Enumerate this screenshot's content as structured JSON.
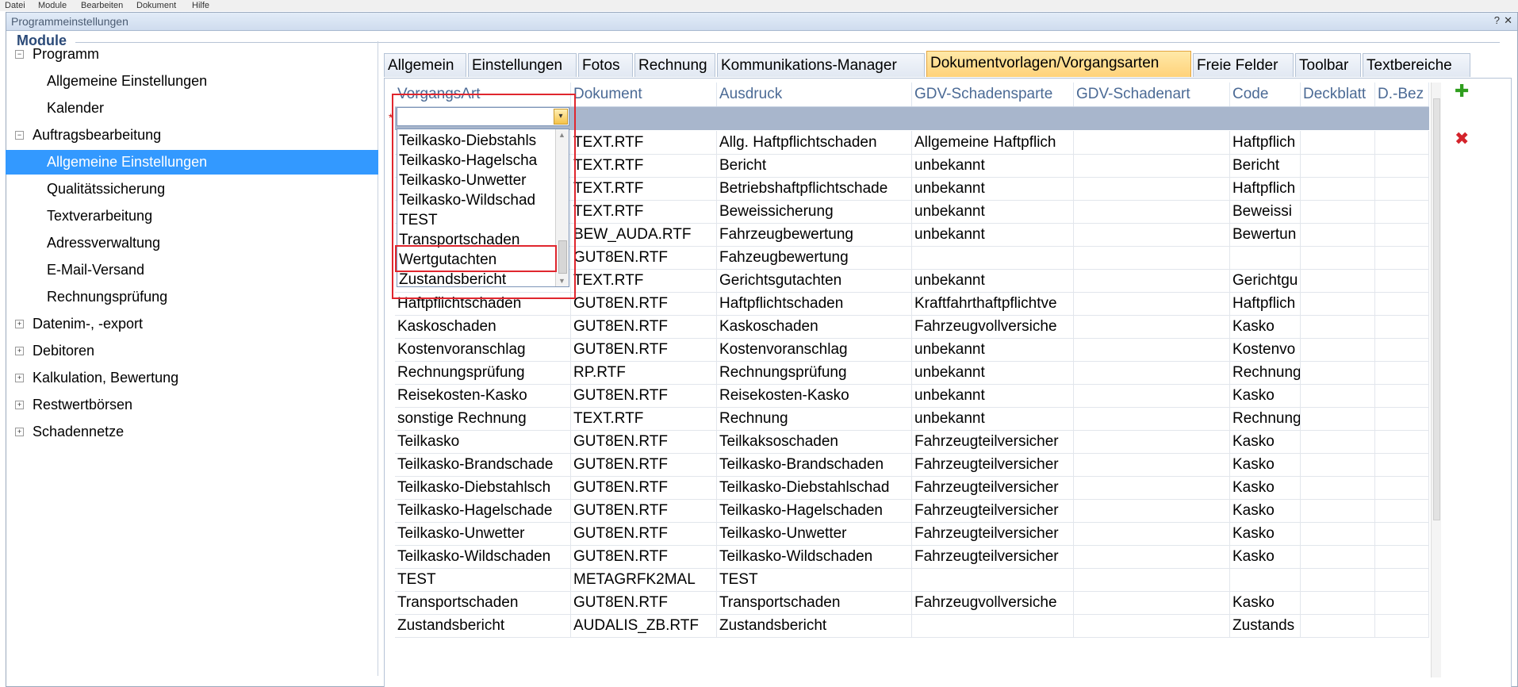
{
  "menubar": [
    "Datei",
    "Module",
    "Bearbeiten",
    "Dokument",
    "Hilfe"
  ],
  "window": {
    "title": "Programmeinstellungen",
    "help": "?",
    "close": "✕"
  },
  "panel_title": "Module",
  "tree": [
    {
      "label": "Programm",
      "level": 0,
      "toggle": "−"
    },
    {
      "label": "Allgemeine Einstellungen",
      "level": 1
    },
    {
      "label": "Kalender",
      "level": 1
    },
    {
      "label": "Auftragsbearbeitung",
      "level": 0,
      "toggle": "−"
    },
    {
      "label": "Allgemeine Einstellungen",
      "level": 1,
      "selected": true
    },
    {
      "label": "Qualitätssicherung",
      "level": 1
    },
    {
      "label": "Textverarbeitung",
      "level": 1
    },
    {
      "label": "Adressverwaltung",
      "level": 1
    },
    {
      "label": "E-Mail-Versand",
      "level": 1
    },
    {
      "label": "Rechnungsprüfung",
      "level": 1
    },
    {
      "label": "Datenim-, -export",
      "level": 0,
      "toggle": "+"
    },
    {
      "label": "Debitoren",
      "level": 0,
      "toggle": "+"
    },
    {
      "label": "Kalkulation, Bewertung",
      "level": 0,
      "toggle": "+"
    },
    {
      "label": "Restwertbörsen",
      "level": 0,
      "toggle": "+"
    },
    {
      "label": "Schadennetze",
      "level": 0,
      "toggle": "+"
    }
  ],
  "tabs": [
    {
      "label": "Allgemein"
    },
    {
      "label": "Einstellungen"
    },
    {
      "label": "Fotos"
    },
    {
      "label": "Rechnung"
    },
    {
      "label": "Kommunikations-Manager"
    },
    {
      "label": "Dokumentvorlagen/Vorgangsarten",
      "active": true
    },
    {
      "label": "Freie Felder"
    },
    {
      "label": "Toolbar"
    },
    {
      "label": "Textbereiche"
    }
  ],
  "columns": [
    "VorgangsArt",
    "Dokument",
    "Ausdruck",
    "GDV-Schadensparte",
    "GDV-Schadenart",
    "Code",
    "Deckblatt",
    "D.-Bez"
  ],
  "new_row_marker": "*",
  "rows": [
    [
      "",
      "TEXT.RTF",
      "Allg. Haftpflichtschaden",
      "Allgemeine Haftpflich",
      "",
      "Haftpflich",
      "",
      ""
    ],
    [
      "",
      "TEXT.RTF",
      "Bericht",
      "unbekannt",
      "",
      "Bericht",
      "",
      ""
    ],
    [
      "",
      "TEXT.RTF",
      "Betriebshaftpflichtschade",
      "unbekannt",
      "",
      "Haftpflich",
      "",
      ""
    ],
    [
      "",
      "TEXT.RTF",
      "Beweissicherung",
      "unbekannt",
      "",
      "Beweissi",
      "",
      ""
    ],
    [
      "",
      "BEW_AUDA.RTF",
      "Fahrzeugbewertung",
      "unbekannt",
      "",
      "Bewertun",
      "",
      ""
    ],
    [
      "",
      "GUT8EN.RTF",
      "Fahzeugbewertung",
      "",
      "",
      "",
      "",
      ""
    ],
    [
      "",
      "TEXT.RTF",
      "Gerichtsgutachten",
      "unbekannt",
      "",
      "Gerichtgu",
      "",
      ""
    ],
    [
      "Haftpflichtschaden",
      "GUT8EN.RTF",
      "Haftpflichtschaden",
      "Kraftfahrthaftpflichtve",
      "",
      "Haftpflich",
      "",
      ""
    ],
    [
      "Kaskoschaden",
      "GUT8EN.RTF",
      "Kaskoschaden",
      "Fahrzeugvollversiche",
      "",
      "Kasko",
      "",
      ""
    ],
    [
      "Kostenvoranschlag",
      "GUT8EN.RTF",
      "Kostenvoranschlag",
      "unbekannt",
      "",
      "Kostenvo",
      "",
      ""
    ],
    [
      "Rechnungsprüfung",
      "RP.RTF",
      "Rechnungsprüfung",
      "unbekannt",
      "",
      "Rechnung",
      "",
      ""
    ],
    [
      "Reisekosten-Kasko",
      "GUT8EN.RTF",
      "Reisekosten-Kasko",
      "unbekannt",
      "",
      "Kasko",
      "",
      ""
    ],
    [
      "sonstige Rechnung",
      "TEXT.RTF",
      "Rechnung",
      "unbekannt",
      "",
      "Rechnung",
      "",
      ""
    ],
    [
      "Teilkasko",
      "GUT8EN.RTF",
      "Teilkaksoschaden",
      "Fahrzeugteilversicher",
      "",
      "Kasko",
      "",
      ""
    ],
    [
      "Teilkasko-Brandschade",
      "GUT8EN.RTF",
      "Teilkasko-Brandschaden",
      "Fahrzeugteilversicher",
      "",
      "Kasko",
      "",
      ""
    ],
    [
      "Teilkasko-Diebstahlsch",
      "GUT8EN.RTF",
      "Teilkasko-Diebstahlschad",
      "Fahrzeugteilversicher",
      "",
      "Kasko",
      "",
      ""
    ],
    [
      "Teilkasko-Hagelschade",
      "GUT8EN.RTF",
      "Teilkasko-Hagelschaden",
      "Fahrzeugteilversicher",
      "",
      "Kasko",
      "",
      ""
    ],
    [
      "Teilkasko-Unwetter",
      "GUT8EN.RTF",
      "Teilkasko-Unwetter",
      "Fahrzeugteilversicher",
      "",
      "Kasko",
      "",
      ""
    ],
    [
      "Teilkasko-Wildschaden",
      "GUT8EN.RTF",
      "Teilkasko-Wildschaden",
      "Fahrzeugteilversicher",
      "",
      "Kasko",
      "",
      ""
    ],
    [
      "TEST",
      "METAGRFK2MAL",
      "TEST",
      "",
      "",
      "",
      "",
      ""
    ],
    [
      "Transportschaden",
      "GUT8EN.RTF",
      "Transportschaden",
      "Fahrzeugvollversiche",
      "",
      "Kasko",
      "",
      ""
    ],
    [
      "Zustandsbericht",
      "AUDALIS_ZB.RTF",
      "Zustandsbericht",
      "",
      "",
      "Zustands",
      "",
      ""
    ]
  ],
  "combo": {
    "value": "",
    "button": "▾",
    "options": [
      "Teilkasko-Diebstahls",
      "Teilkasko-Hagelscha",
      "Teilkasko-Unwetter",
      "Teilkasko-Wildschad",
      "TEST",
      "Transportschaden",
      "Wertgutachten",
      "Zustandsbericht"
    ],
    "highlighted": "Wertgutachten"
  },
  "side_buttons": {
    "add": "✚",
    "delete": "✖"
  },
  "colors": {
    "selection": "#3399ff",
    "active_tab": "#ffd27a",
    "add": "#2f9e1e",
    "delete": "#d4232b",
    "highlight_box": "#e0262e"
  }
}
